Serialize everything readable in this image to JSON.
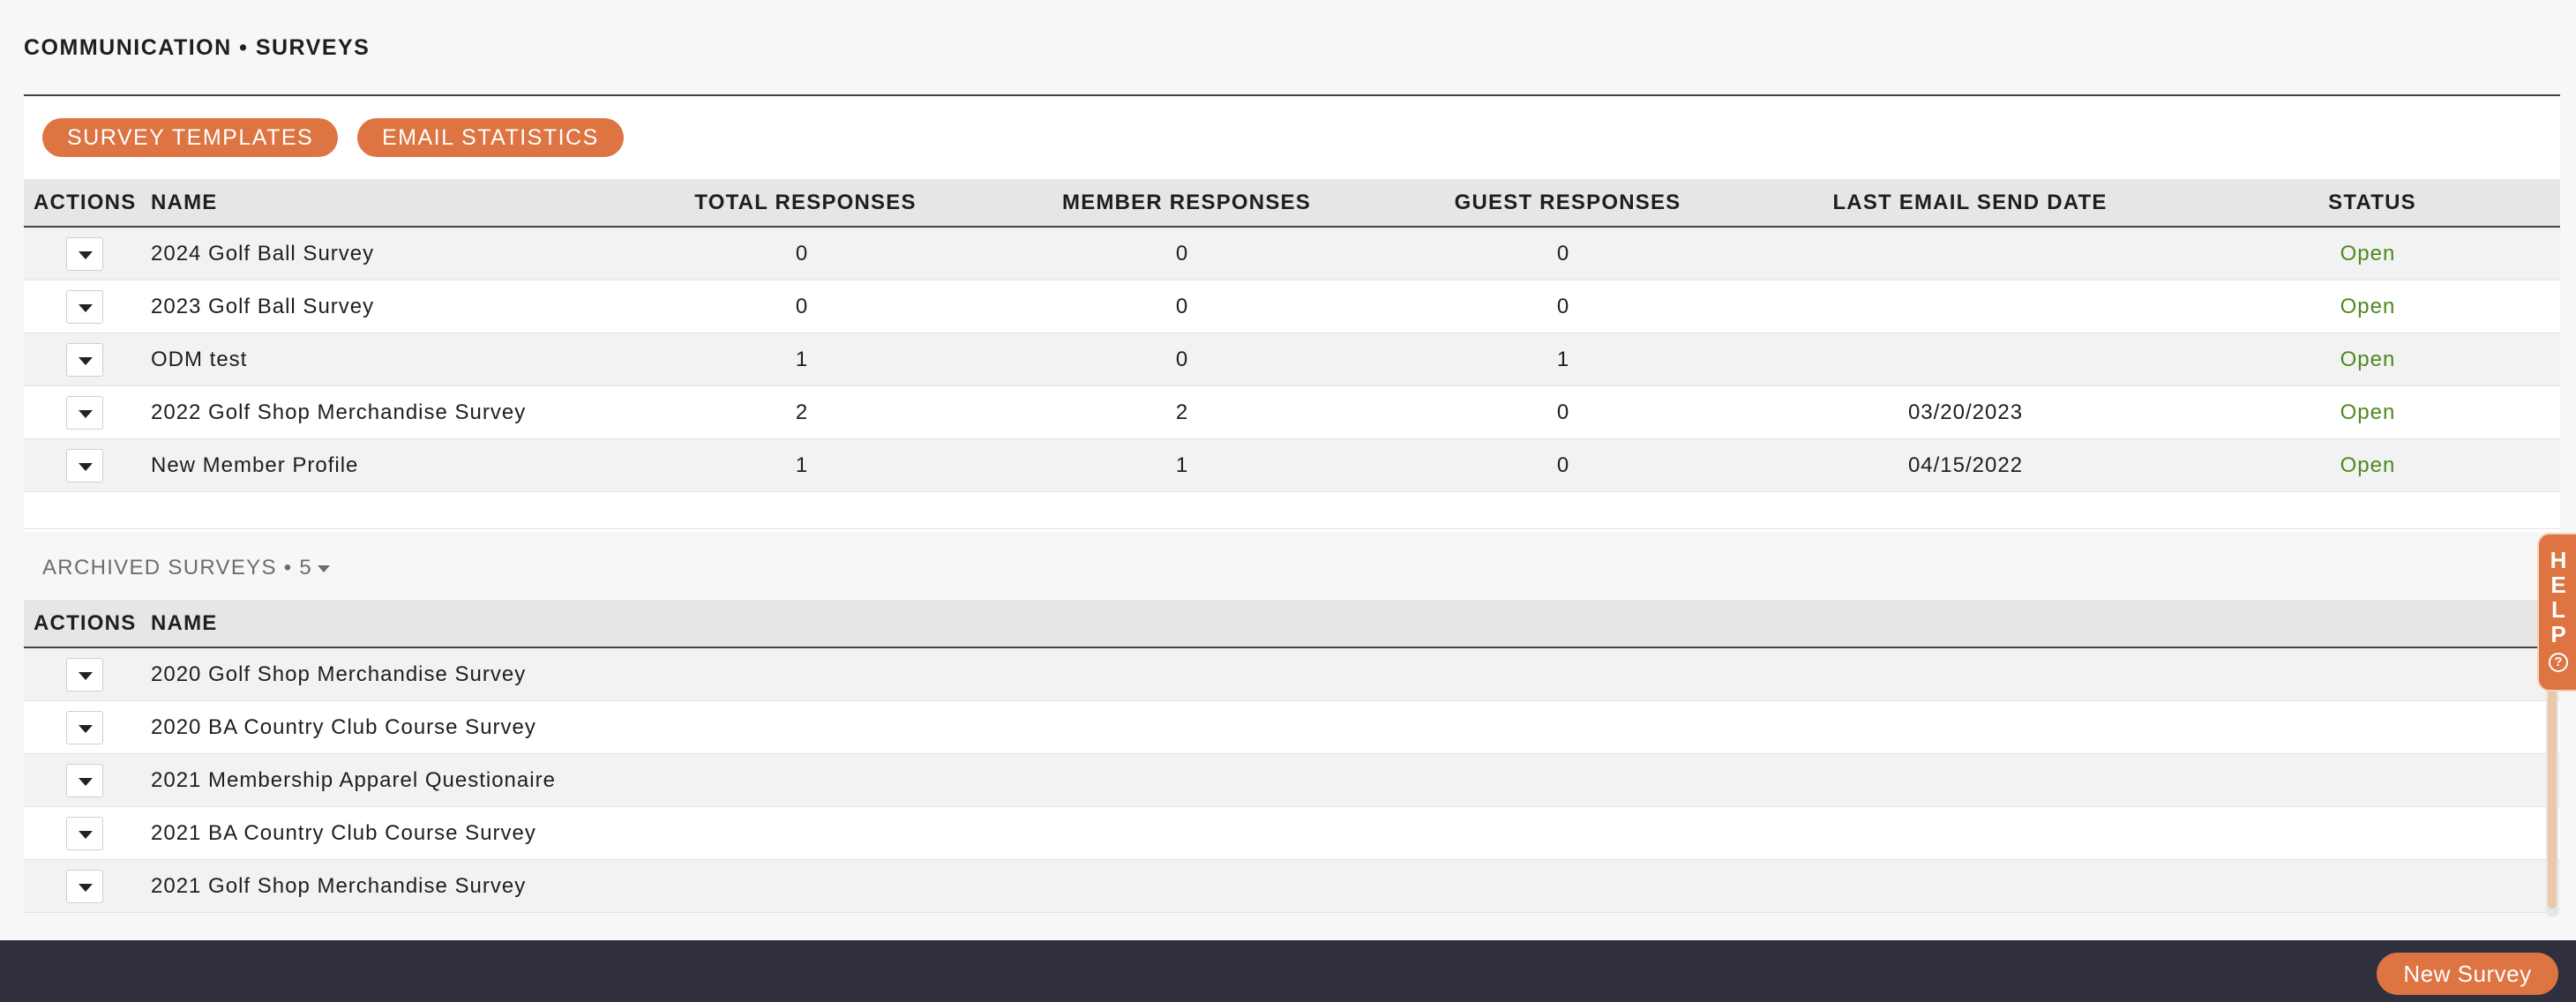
{
  "header": {
    "title": "COMMUNICATION • SURVEYS"
  },
  "toolbar": {
    "survey_templates_label": "SURVEY TEMPLATES",
    "email_statistics_label": "EMAIL STATISTICS"
  },
  "surveys_table": {
    "columns": {
      "actions": "ACTIONS",
      "name": "NAME",
      "total": "TOTAL RESPONSES",
      "member": "MEMBER RESPONSES",
      "guest": "GUEST RESPONSES",
      "last_email": "LAST EMAIL SEND DATE",
      "status": "STATUS"
    },
    "rows": [
      {
        "name": "2024 Golf Ball Survey",
        "total": "0",
        "member": "0",
        "guest": "0",
        "last_email": "",
        "status": "Open"
      },
      {
        "name": "2023 Golf Ball Survey",
        "total": "0",
        "member": "0",
        "guest": "0",
        "last_email": "",
        "status": "Open"
      },
      {
        "name": "ODM test",
        "total": "1",
        "member": "0",
        "guest": "1",
        "last_email": "",
        "status": "Open"
      },
      {
        "name": "2022 Golf Shop Merchandise Survey",
        "total": "2",
        "member": "2",
        "guest": "0",
        "last_email": "03/20/2023",
        "status": "Open"
      },
      {
        "name": "New Member Profile",
        "total": "1",
        "member": "1",
        "guest": "0",
        "last_email": "04/15/2022",
        "status": "Open"
      }
    ]
  },
  "archived": {
    "header_label": "ARCHIVED SURVEYS • 5",
    "columns": {
      "actions": "ACTIONS",
      "name": "NAME"
    },
    "rows": [
      {
        "name": "2020 Golf Shop Merchandise Survey"
      },
      {
        "name": "2020 BA Country Club Course Survey"
      },
      {
        "name": "2021 Membership Apparel Questionaire"
      },
      {
        "name": "2021 BA Country Club Course Survey"
      },
      {
        "name": "2021 Golf Shop Merchandise Survey"
      }
    ]
  },
  "help": {
    "letters": [
      "H",
      "E",
      "L",
      "P"
    ],
    "icon": "question-circle-icon",
    "q": "?"
  },
  "footer": {
    "new_survey_label": "New Survey"
  },
  "colors": {
    "accent": "#dd7442",
    "status_open": "#4d8a1d",
    "footer_bg": "#2f2f3d"
  }
}
